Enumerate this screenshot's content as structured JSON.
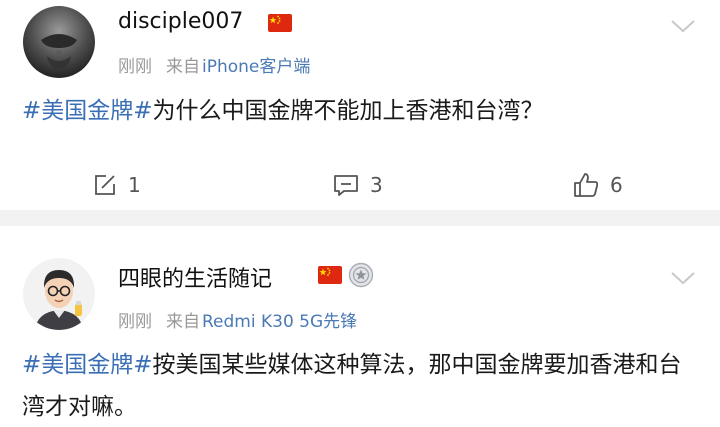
{
  "posts": [
    {
      "username": "disciple007",
      "time": "刚刚",
      "source_label": "来自",
      "device": "iPhone客户端",
      "hashtag": "#美国金牌#",
      "text": "为什么中国金牌不能加上香港和台湾？",
      "reposts": "1",
      "comments": "3",
      "likes": "6"
    },
    {
      "username": "四眼的生活随记",
      "time": "刚刚",
      "source_label": "来自",
      "device": "Redmi K30 5G先锋",
      "hashtag": "#美国金牌#",
      "text": "按美国某些媒体这种算法，那中国金牌要加香港和台湾才对嘛。"
    }
  ],
  "icons": {
    "flag": "china-flag-icon",
    "medal": "silver-medal-badge-icon",
    "more": "chevron-down-icon",
    "repost": "repost-icon",
    "comment": "comment-icon",
    "like": "thumbs-up-icon"
  },
  "colors": {
    "hashtag": "#3a6fb5",
    "device": "#4a7ab5",
    "meta": "#999999",
    "separator": "#f2f2f2",
    "flag_red": "#de2910",
    "flag_star": "#ffde00"
  }
}
